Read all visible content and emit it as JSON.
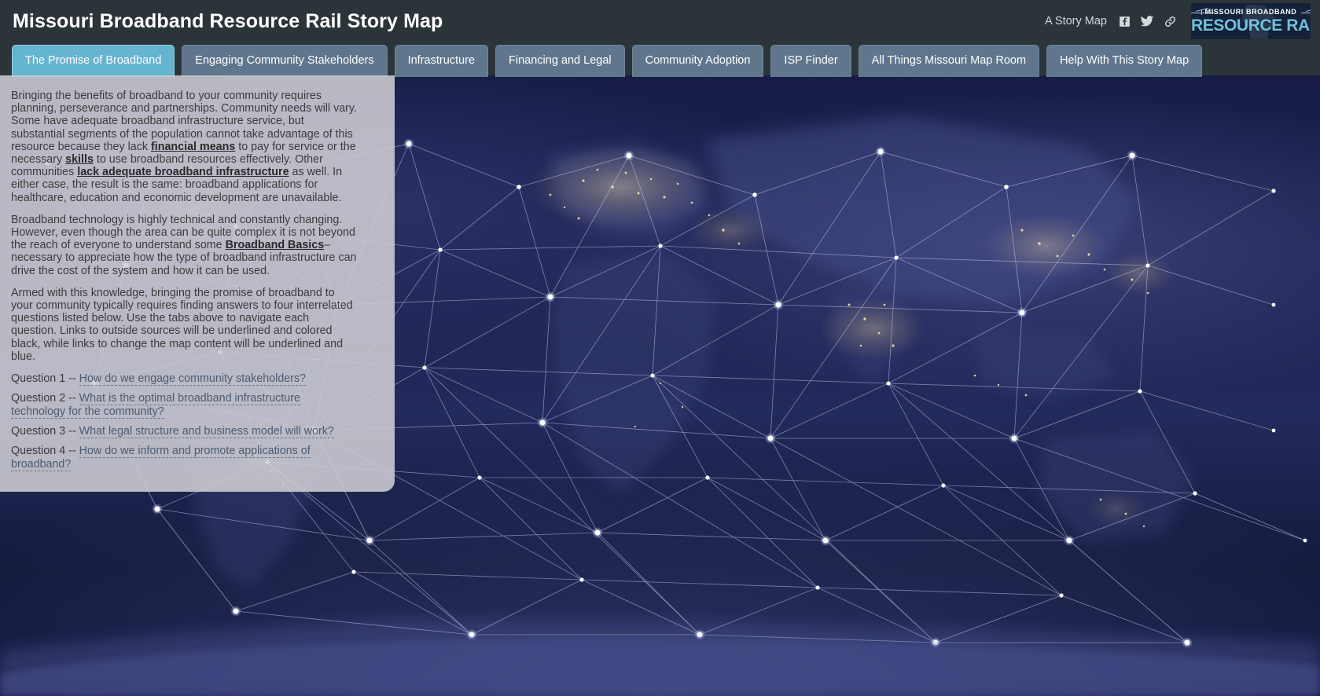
{
  "header": {
    "title": "Missouri Broadband Resource Rail Story Map",
    "story_map_label": "A Story Map",
    "social": [
      {
        "name": "facebook-icon",
        "label": "Facebook"
      },
      {
        "name": "twitter-icon",
        "label": "Twitter"
      },
      {
        "name": "link-icon",
        "label": "Copy link"
      }
    ],
    "logo": {
      "top_text": "MISSOURI BROADBAND",
      "main_text": "RESOURCE RAIL",
      "trademark": "™"
    },
    "colors": {
      "header_bg": "#2b3439",
      "tab_active": "#65b4d0",
      "tab_inactive": "#5f768c",
      "logo_bg": "#142139",
      "logo_accent": "#6fc2dd"
    }
  },
  "tabs": [
    {
      "label": "The Promise of Broadband",
      "active": true
    },
    {
      "label": "Engaging Community Stakeholders",
      "active": false
    },
    {
      "label": "Infrastructure",
      "active": false
    },
    {
      "label": "Financing and Legal",
      "active": false
    },
    {
      "label": "Community Adoption",
      "active": false
    },
    {
      "label": "ISP Finder",
      "active": false
    },
    {
      "label": "All Things Missouri Map Room",
      "active": false
    },
    {
      "label": "Help With This Story Map",
      "active": false
    }
  ],
  "panel": {
    "paragraph1": {
      "part1": "Bringing the benefits of broadband to your community requires planning, perseverance and partnerships. Community needs will vary. Some have adequate broadband infrastructure service, but substantial segments of the population cannot take advantage of this resource because they lack ",
      "link1": "financial means",
      "part2": " to pay for service or the necessary ",
      "link2": "skills",
      "part3": " to use broadband resources effectively. Other communities ",
      "link3": "lack adequate broadband infrastructure",
      "part4": " as well. In either case, the result is the same: broadband applications for healthcare, education and economic development are unavailable."
    },
    "paragraph2": {
      "part1": "Broadband technology is highly technical and constantly changing. However, even though the area can be quite complex it is not beyond the reach of everyone to understand some ",
      "link1": "Broadband Basics",
      "part2": "–necessary to appreciate how the type of broadband infrastructure can drive the cost of the system and how it can be used."
    },
    "paragraph3": "Armed with this knowledge, bringing the promise of broadband to your community typically requires finding answers to four interrelated questions listed below. Use the tabs above to navigate each question. Links to outside sources will be underlined and colored black, while links to change the map content will be underlined and blue.",
    "questions": [
      {
        "prefix": "Question 1 -- ",
        "link": "How do we engage community stakeholders?"
      },
      {
        "prefix": "Question 2 -- ",
        "link": "What is the optimal broadband infrastructure technology for the community?"
      },
      {
        "prefix": "Question 3 -- ",
        "link": "What legal structure and business model will work?"
      },
      {
        "prefix": "Question 4 -- ",
        "link": "How do we inform and promote applications of broadband?"
      }
    ]
  },
  "map": {
    "description": "Earth at night satellite basemap with network constellation overlay"
  }
}
